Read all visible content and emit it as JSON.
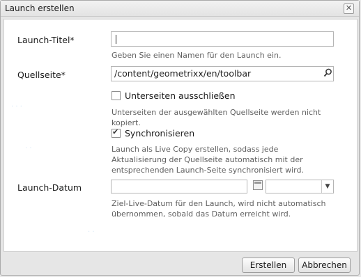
{
  "dialog": {
    "title": "Launch erstellen",
    "close_icon": "close-icon",
    "fields": {
      "launch_title": {
        "label": "Launch-Titel*",
        "value": "",
        "help": "Geben Sie einen Namen für den Launch ein."
      },
      "source_page": {
        "label": "Quellseite*",
        "value": "/content/geometrixx/en/toolbar",
        "search_icon": "search-icon"
      },
      "exclude_subpages": {
        "label": "Unterseiten ausschließen",
        "checked": false,
        "help": "Unterseiten der ausgewählten Quellseite werden nicht kopiert."
      },
      "synchronize": {
        "label": "Synchronisieren",
        "checked": true,
        "help": "Launch als Live Copy erstellen, sodass jede Aktualisierung der Quellseite automatisch mit der entsprechenden Launch-Seite synchronisiert wird."
      },
      "launch_date": {
        "label": "Launch-Datum",
        "date_value": "",
        "time_value": "",
        "calendar_icon": "calendar-icon",
        "help": "Ziel-Live-Datum für den Launch, wird nicht automatisch übernommen, sobald das Datum erreicht wird."
      }
    },
    "buttons": {
      "create": "Erstellen",
      "cancel": "Abbrechen"
    }
  }
}
